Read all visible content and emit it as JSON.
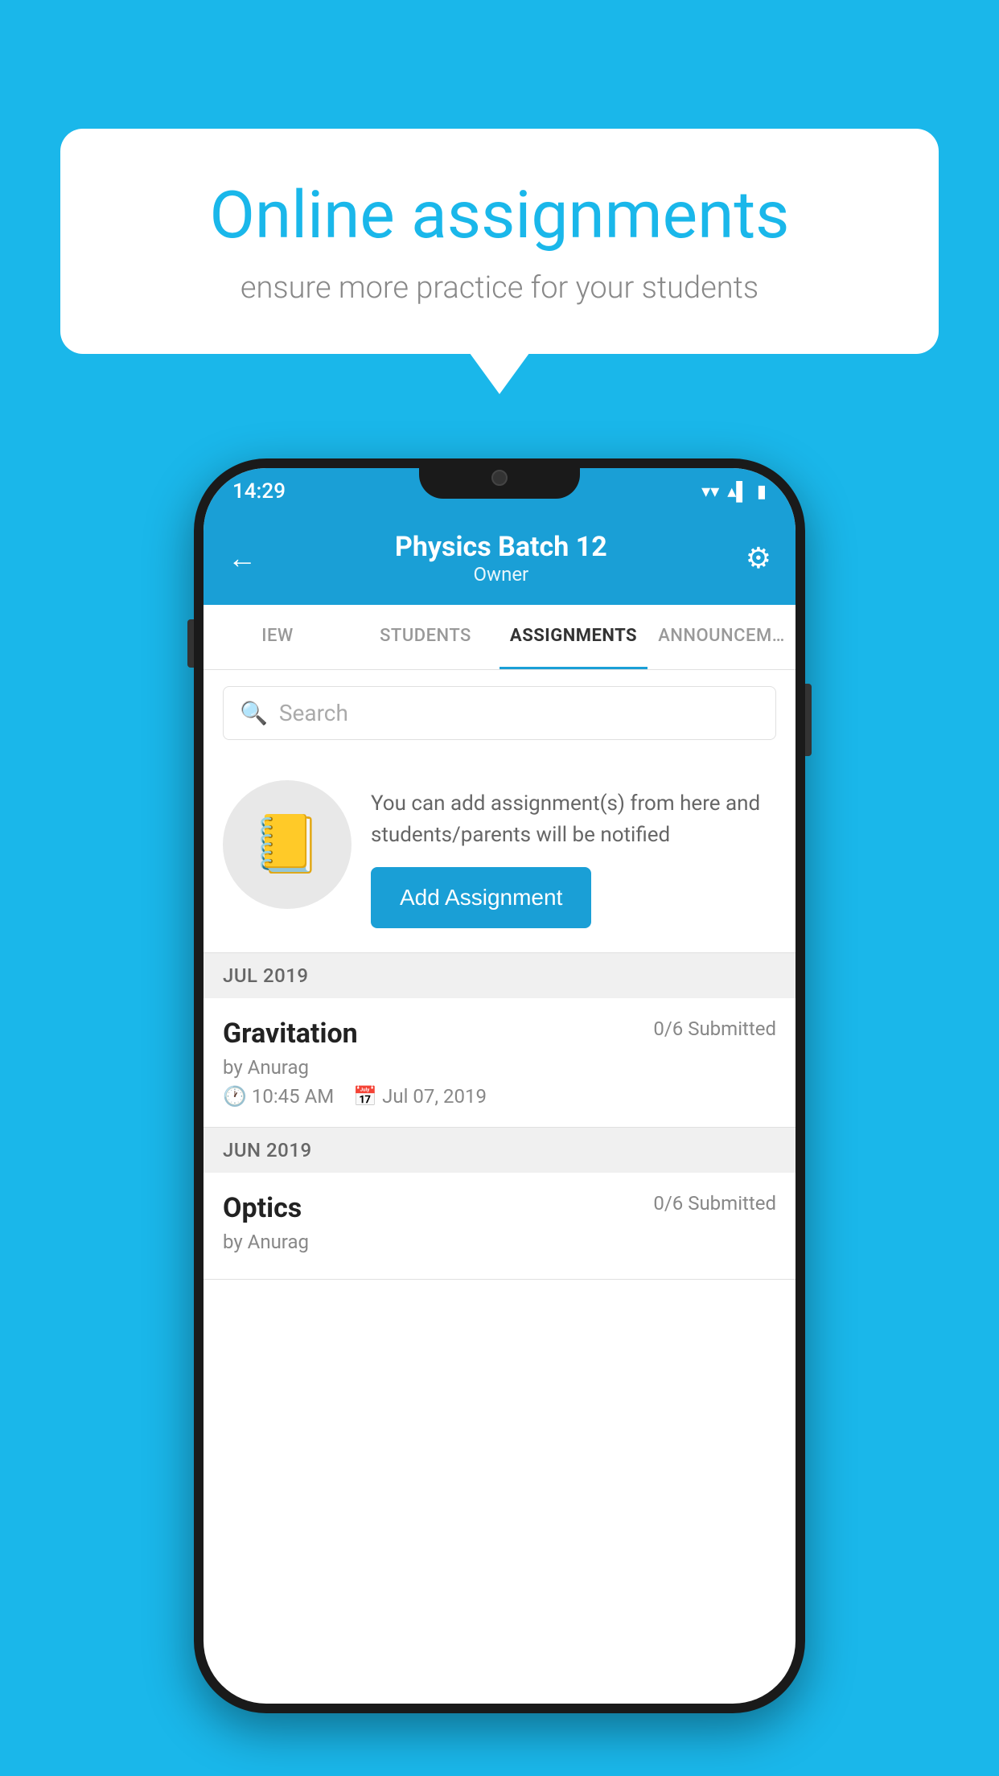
{
  "background_color": "#1ab7ea",
  "speech_bubble": {
    "title": "Online assignments",
    "subtitle": "ensure more practice for your students"
  },
  "status_bar": {
    "time": "14:29",
    "wifi": "▾",
    "signal": "▴",
    "battery": "▮"
  },
  "header": {
    "title": "Physics Batch 12",
    "subtitle": "Owner",
    "back_label": "←",
    "settings_label": "⚙"
  },
  "tabs": [
    {
      "label": "IEW",
      "active": false
    },
    {
      "label": "STUDENTS",
      "active": false
    },
    {
      "label": "ASSIGNMENTS",
      "active": true
    },
    {
      "label": "ANNOUNCEM...",
      "active": false
    }
  ],
  "search": {
    "placeholder": "Search"
  },
  "promo_card": {
    "description": "You can add assignment(s) from here and students/parents will be notified",
    "button_label": "Add Assignment"
  },
  "sections": [
    {
      "month_label": "JUL 2019",
      "assignments": [
        {
          "title": "Gravitation",
          "submitted": "0/6 Submitted",
          "by": "by Anurag",
          "time": "10:45 AM",
          "date": "Jul 07, 2019"
        }
      ]
    },
    {
      "month_label": "JUN 2019",
      "assignments": [
        {
          "title": "Optics",
          "submitted": "0/6 Submitted",
          "by": "by Anurag",
          "time": "",
          "date": ""
        }
      ]
    }
  ]
}
